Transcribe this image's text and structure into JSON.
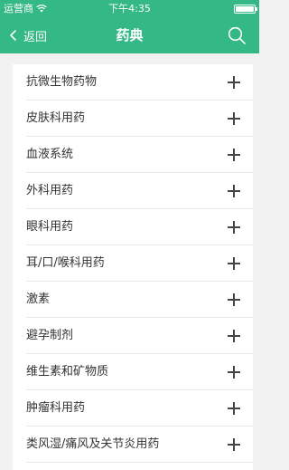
{
  "status_bar": {
    "carrier": "运营商",
    "time": "下午4:35"
  },
  "nav": {
    "back_label": "返回",
    "title": "药典"
  },
  "categories": [
    {
      "label": "抗微生物药物"
    },
    {
      "label": "皮肤科用药"
    },
    {
      "label": "血液系统"
    },
    {
      "label": "外科用药"
    },
    {
      "label": "眼科用药"
    },
    {
      "label": "耳/口/喉科用药"
    },
    {
      "label": "激素"
    },
    {
      "label": "避孕制剂"
    },
    {
      "label": "维生素和矿物质"
    },
    {
      "label": "肿瘤科用药"
    },
    {
      "label": "类风湿/痛风及关节炎用药"
    }
  ],
  "colors": {
    "accent": "#34b885",
    "background": "#f2f2f2",
    "card": "#ffffff"
  },
  "icons": {
    "back": "chevron-left-icon",
    "search": "search-icon",
    "expand": "plus-icon"
  }
}
